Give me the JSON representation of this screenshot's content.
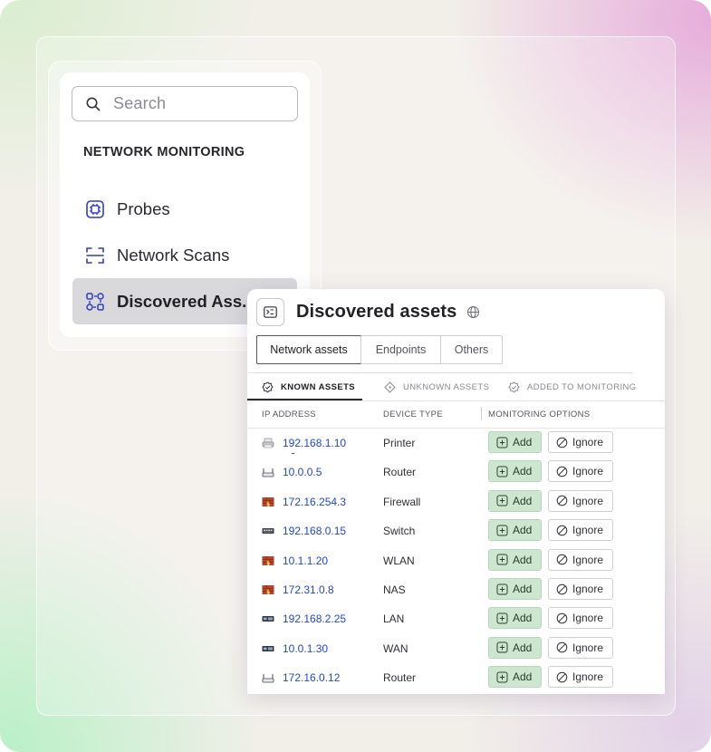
{
  "sidebar": {
    "search_placeholder": "Search",
    "section_title": "NETWORK MONITORING",
    "items": [
      {
        "label": "Probes",
        "icon": "chip-icon"
      },
      {
        "label": "Network Scans",
        "icon": "scan-frame-icon"
      },
      {
        "label": "Discovered Ass...",
        "icon": "discover-icon",
        "active": true
      }
    ]
  },
  "panel": {
    "title": "Discovered assets",
    "segments": [
      {
        "label": "Network assets",
        "active": true
      },
      {
        "label": "Endpoints"
      },
      {
        "label": "Others"
      }
    ],
    "subtabs": [
      {
        "label": "KNOWN ASSETS",
        "active": true
      },
      {
        "label": "UNKNOWN ASSETS"
      },
      {
        "label": "ADDED TO MONITORING"
      }
    ],
    "columns": {
      "ip": "IP ADDRESS",
      "device": "DEVICE TYPE",
      "options": "MONITORING OPTIONS"
    },
    "add_label": "Add",
    "ignore_label": "Ignore",
    "rows": [
      {
        "ip": "192.168.1.10",
        "device": "Printer",
        "icon": "printer-icon"
      },
      {
        "ip": "10.0.0.5",
        "device": "Router",
        "icon": "router-icon"
      },
      {
        "ip": "172.16.254.3",
        "device": "Firewall",
        "icon": "firewall-icon"
      },
      {
        "ip": "192.168.0.15",
        "device": "Switch",
        "icon": "switch-icon"
      },
      {
        "ip": "10.1.1.20",
        "device": "WLAN",
        "icon": "firewall-icon"
      },
      {
        "ip": "172.31.0.8",
        "device": "NAS",
        "icon": "firewall-icon"
      },
      {
        "ip": "192.168.2.25",
        "device": "LAN",
        "icon": "lan-icon"
      },
      {
        "ip": "10.0.1.30",
        "device": "WAN",
        "icon": "lan-icon"
      },
      {
        "ip": "172.16.0.12",
        "device": "Router",
        "icon": "router-icon"
      }
    ]
  },
  "colors": {
    "accent_link": "#2348c9",
    "add_button_bg": "#cde6cf",
    "firewall_orange": "#d9572b"
  }
}
